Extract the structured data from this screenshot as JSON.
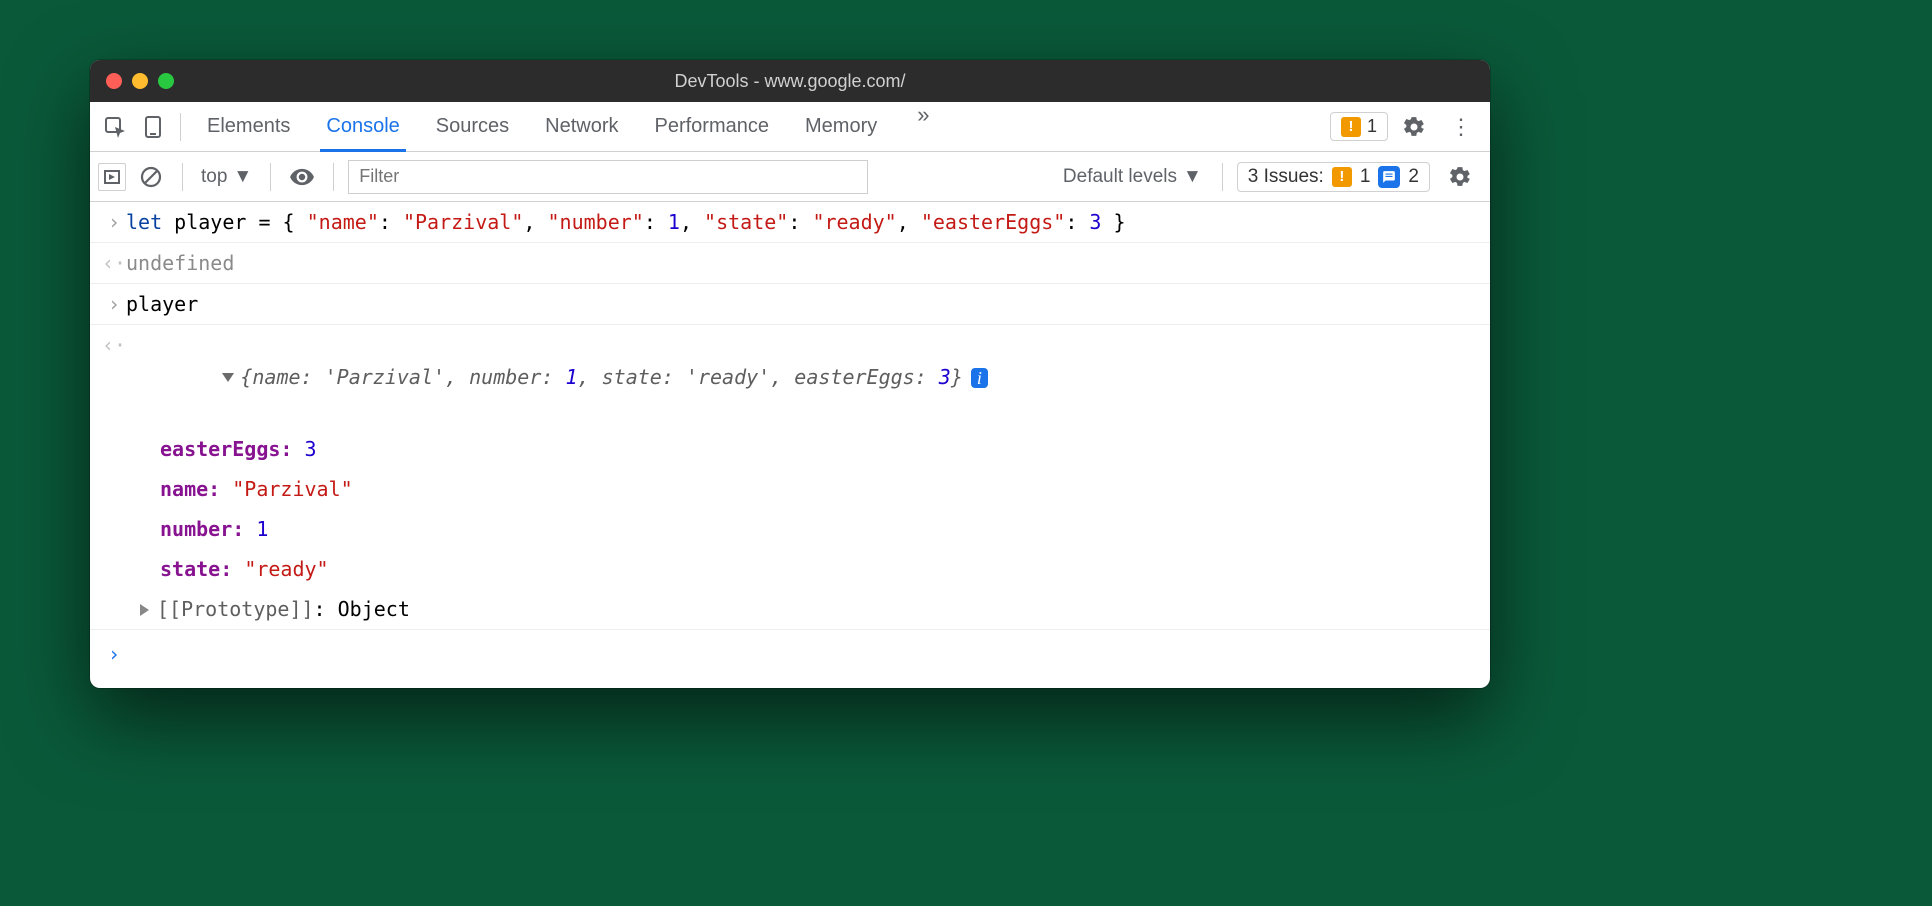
{
  "window": {
    "title": "DevTools - www.google.com/"
  },
  "tabs": {
    "items": [
      "Elements",
      "Console",
      "Sources",
      "Network",
      "Performance",
      "Memory"
    ],
    "active": "Console"
  },
  "toolbar": {
    "warning_count": "1"
  },
  "filterbar": {
    "context": "top",
    "filter_placeholder": "Filter",
    "levels_label": "Default levels",
    "issues_label": "3 Issues:",
    "issues_warn": "1",
    "issues_info": "2"
  },
  "console": {
    "input1_prefix": "let",
    "input1_var": " player = { ",
    "input1_k1": "\"name\"",
    "input1_v1": "\"Parzival\"",
    "input1_k2": "\"number\"",
    "input1_v2": "1",
    "input1_k3": "\"state\"",
    "input1_v3": "\"ready\"",
    "input1_k4": "\"easterEggs\"",
    "input1_v4": "3",
    "input1_close": " }",
    "result1": "undefined",
    "input2": "player",
    "summary_open": "{",
    "summary_k1": "name: ",
    "summary_v1": "'Parzival'",
    "summary_sep": ", ",
    "summary_k2": "number: ",
    "summary_v2": "1",
    "summary_k3": "state: ",
    "summary_v3": "'ready'",
    "summary_k4": "easterEggs: ",
    "summary_v4": "3",
    "summary_close": "}",
    "prop1_key": "easterEggs",
    "prop1_val": "3",
    "prop2_key": "name",
    "prop2_val": "\"Parzival\"",
    "prop3_key": "number",
    "prop3_val": "1",
    "prop4_key": "state",
    "prop4_val": "\"ready\"",
    "proto_label": "[[Prototype]]",
    "proto_val": "Object"
  }
}
